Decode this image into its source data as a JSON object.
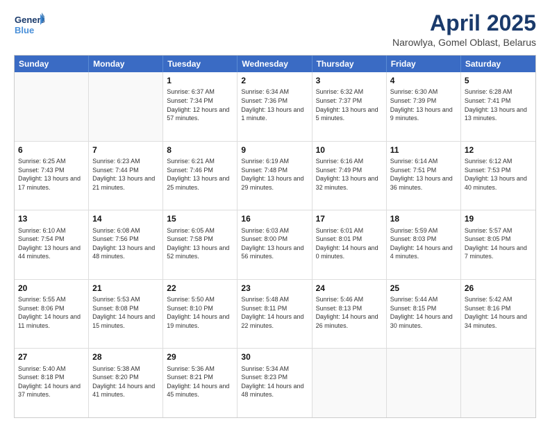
{
  "logo": {
    "line1": "General",
    "line2": "Blue"
  },
  "title": "April 2025",
  "subtitle": "Narowlya, Gomel Oblast, Belarus",
  "header_days": [
    "Sunday",
    "Monday",
    "Tuesday",
    "Wednesday",
    "Thursday",
    "Friday",
    "Saturday"
  ],
  "rows": [
    [
      {
        "day": "",
        "info": ""
      },
      {
        "day": "",
        "info": ""
      },
      {
        "day": "1",
        "info": "Sunrise: 6:37 AM\nSunset: 7:34 PM\nDaylight: 12 hours and 57 minutes."
      },
      {
        "day": "2",
        "info": "Sunrise: 6:34 AM\nSunset: 7:36 PM\nDaylight: 13 hours and 1 minute."
      },
      {
        "day": "3",
        "info": "Sunrise: 6:32 AM\nSunset: 7:37 PM\nDaylight: 13 hours and 5 minutes."
      },
      {
        "day": "4",
        "info": "Sunrise: 6:30 AM\nSunset: 7:39 PM\nDaylight: 13 hours and 9 minutes."
      },
      {
        "day": "5",
        "info": "Sunrise: 6:28 AM\nSunset: 7:41 PM\nDaylight: 13 hours and 13 minutes."
      }
    ],
    [
      {
        "day": "6",
        "info": "Sunrise: 6:25 AM\nSunset: 7:43 PM\nDaylight: 13 hours and 17 minutes."
      },
      {
        "day": "7",
        "info": "Sunrise: 6:23 AM\nSunset: 7:44 PM\nDaylight: 13 hours and 21 minutes."
      },
      {
        "day": "8",
        "info": "Sunrise: 6:21 AM\nSunset: 7:46 PM\nDaylight: 13 hours and 25 minutes."
      },
      {
        "day": "9",
        "info": "Sunrise: 6:19 AM\nSunset: 7:48 PM\nDaylight: 13 hours and 29 minutes."
      },
      {
        "day": "10",
        "info": "Sunrise: 6:16 AM\nSunset: 7:49 PM\nDaylight: 13 hours and 32 minutes."
      },
      {
        "day": "11",
        "info": "Sunrise: 6:14 AM\nSunset: 7:51 PM\nDaylight: 13 hours and 36 minutes."
      },
      {
        "day": "12",
        "info": "Sunrise: 6:12 AM\nSunset: 7:53 PM\nDaylight: 13 hours and 40 minutes."
      }
    ],
    [
      {
        "day": "13",
        "info": "Sunrise: 6:10 AM\nSunset: 7:54 PM\nDaylight: 13 hours and 44 minutes."
      },
      {
        "day": "14",
        "info": "Sunrise: 6:08 AM\nSunset: 7:56 PM\nDaylight: 13 hours and 48 minutes."
      },
      {
        "day": "15",
        "info": "Sunrise: 6:05 AM\nSunset: 7:58 PM\nDaylight: 13 hours and 52 minutes."
      },
      {
        "day": "16",
        "info": "Sunrise: 6:03 AM\nSunset: 8:00 PM\nDaylight: 13 hours and 56 minutes."
      },
      {
        "day": "17",
        "info": "Sunrise: 6:01 AM\nSunset: 8:01 PM\nDaylight: 14 hours and 0 minutes."
      },
      {
        "day": "18",
        "info": "Sunrise: 5:59 AM\nSunset: 8:03 PM\nDaylight: 14 hours and 4 minutes."
      },
      {
        "day": "19",
        "info": "Sunrise: 5:57 AM\nSunset: 8:05 PM\nDaylight: 14 hours and 7 minutes."
      }
    ],
    [
      {
        "day": "20",
        "info": "Sunrise: 5:55 AM\nSunset: 8:06 PM\nDaylight: 14 hours and 11 minutes."
      },
      {
        "day": "21",
        "info": "Sunrise: 5:53 AM\nSunset: 8:08 PM\nDaylight: 14 hours and 15 minutes."
      },
      {
        "day": "22",
        "info": "Sunrise: 5:50 AM\nSunset: 8:10 PM\nDaylight: 14 hours and 19 minutes."
      },
      {
        "day": "23",
        "info": "Sunrise: 5:48 AM\nSunset: 8:11 PM\nDaylight: 14 hours and 22 minutes."
      },
      {
        "day": "24",
        "info": "Sunrise: 5:46 AM\nSunset: 8:13 PM\nDaylight: 14 hours and 26 minutes."
      },
      {
        "day": "25",
        "info": "Sunrise: 5:44 AM\nSunset: 8:15 PM\nDaylight: 14 hours and 30 minutes."
      },
      {
        "day": "26",
        "info": "Sunrise: 5:42 AM\nSunset: 8:16 PM\nDaylight: 14 hours and 34 minutes."
      }
    ],
    [
      {
        "day": "27",
        "info": "Sunrise: 5:40 AM\nSunset: 8:18 PM\nDaylight: 14 hours and 37 minutes."
      },
      {
        "day": "28",
        "info": "Sunrise: 5:38 AM\nSunset: 8:20 PM\nDaylight: 14 hours and 41 minutes."
      },
      {
        "day": "29",
        "info": "Sunrise: 5:36 AM\nSunset: 8:21 PM\nDaylight: 14 hours and 45 minutes."
      },
      {
        "day": "30",
        "info": "Sunrise: 5:34 AM\nSunset: 8:23 PM\nDaylight: 14 hours and 48 minutes."
      },
      {
        "day": "",
        "info": ""
      },
      {
        "day": "",
        "info": ""
      },
      {
        "day": "",
        "info": ""
      }
    ]
  ]
}
